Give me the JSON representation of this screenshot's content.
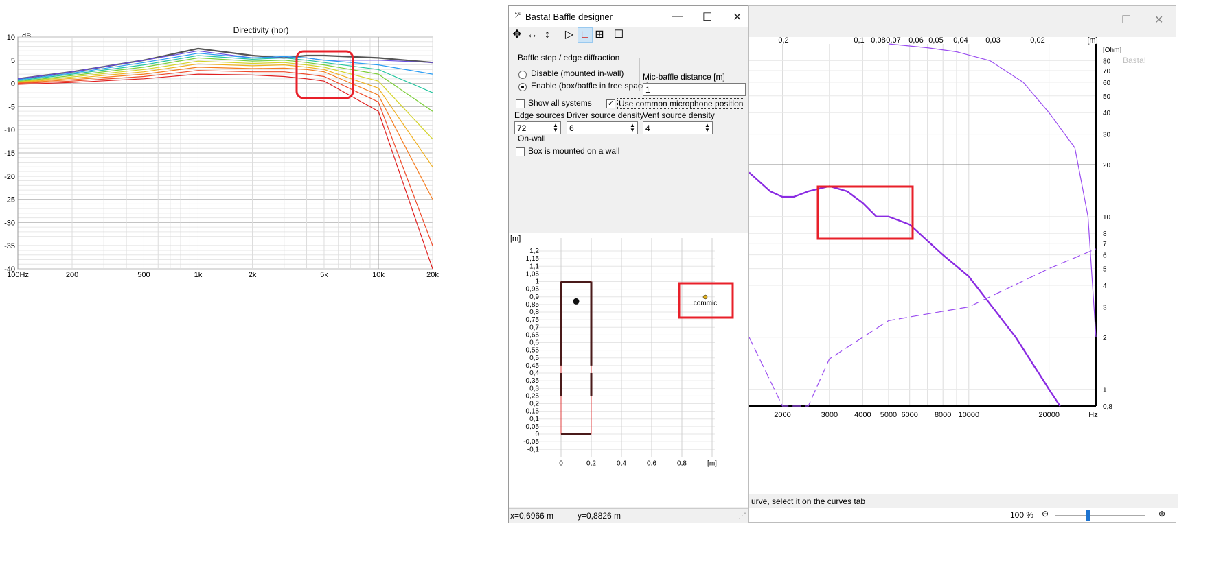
{
  "directivity": {
    "title": "Directivity (hor)",
    "y_unit": "dB",
    "y_ticks": [
      "10",
      "5",
      "0",
      "-5",
      "-10",
      "-15",
      "-20",
      "-25",
      "-30",
      "-35",
      "-40"
    ],
    "x_ticks": [
      "100Hz",
      "200",
      "500",
      "1k",
      "2k",
      "5k",
      "10k",
      "20k"
    ]
  },
  "chart_data": [
    {
      "type": "line",
      "title": "Directivity (hor)",
      "ylabel": "dB",
      "xlabel": "",
      "x_scale": "log",
      "xlim": [
        100,
        20000
      ],
      "ylim": [
        -40,
        10
      ],
      "grid": true,
      "series": [
        {
          "color": "#555555",
          "x": [
            100,
            200,
            500,
            1000,
            2000,
            3000,
            4000,
            5000,
            10000,
            20000
          ],
          "values": [
            1,
            2.5,
            5,
            7.5,
            6,
            5.5,
            6,
            6,
            5.5,
            4.5
          ]
        },
        {
          "color": "#6a4fe0",
          "x": [
            100,
            200,
            500,
            1000,
            2000,
            3000,
            4000,
            5000,
            10000,
            20000
          ],
          "values": [
            1,
            2.5,
            5,
            7,
            5.5,
            5.5,
            5.5,
            5,
            5,
            4.5
          ]
        },
        {
          "color": "#2a9df4",
          "x": [
            100,
            200,
            500,
            1000,
            2000,
            3000,
            4000,
            5000,
            10000,
            20000
          ],
          "values": [
            0.8,
            2.2,
            4.5,
            6.5,
            5.5,
            5.8,
            5.5,
            5,
            4,
            2
          ]
        },
        {
          "color": "#26c6a0",
          "x": [
            100,
            200,
            500,
            1000,
            2000,
            3000,
            4000,
            5000,
            10000,
            20000
          ],
          "values": [
            0.6,
            2,
            4,
            6,
            5.2,
            5.5,
            5,
            4.5,
            3,
            -2
          ]
        },
        {
          "color": "#7ccf3a",
          "x": [
            100,
            200,
            500,
            1000,
            2000,
            3000,
            4000,
            5000,
            10000,
            20000
          ],
          "values": [
            0.4,
            1.7,
            3.5,
            5.5,
            4.8,
            5,
            4.5,
            4,
            2,
            -6
          ]
        },
        {
          "color": "#d4d42a",
          "x": [
            100,
            200,
            500,
            1000,
            2000,
            3000,
            4000,
            5000,
            10000,
            20000
          ],
          "values": [
            0.3,
            1.4,
            3,
            4.8,
            4.3,
            4.5,
            4,
            3.5,
            0.5,
            -12
          ]
        },
        {
          "color": "#f0b020",
          "x": [
            100,
            200,
            500,
            1000,
            2000,
            3000,
            4000,
            5000,
            10000,
            20000
          ],
          "values": [
            0.2,
            1.1,
            2.5,
            4.2,
            3.8,
            4,
            3.5,
            3,
            -1,
            -18
          ]
        },
        {
          "color": "#f57c1f",
          "x": [
            100,
            200,
            500,
            1000,
            2000,
            3000,
            4000,
            5000,
            10000,
            20000
          ],
          "values": [
            0.1,
            0.8,
            2,
            3.5,
            3.2,
            3.3,
            3,
            2.5,
            -2.5,
            -25
          ]
        },
        {
          "color": "#ef4a2a",
          "x": [
            100,
            200,
            500,
            1000,
            2000,
            3000,
            4000,
            5000,
            10000,
            20000
          ],
          "values": [
            0,
            0.5,
            1.5,
            2.8,
            2.5,
            2.5,
            2,
            1.5,
            -4,
            -35
          ]
        },
        {
          "color": "#e02020",
          "x": [
            100,
            200,
            500,
            1000,
            2000,
            3000,
            4000,
            5000,
            10000,
            20000
          ],
          "values": [
            -0.2,
            0.2,
            1,
            2,
            1.8,
            1.5,
            1,
            0.5,
            -6,
            -40
          ]
        }
      ]
    },
    {
      "type": "line",
      "title": "",
      "x_scale": "log",
      "xlim": [
        1500,
        30000
      ],
      "ylim": [
        0.8,
        100
      ],
      "y_right_unit": "[Ohm]",
      "top_unit": "[m]",
      "grid": true,
      "series": [
        {
          "color": "#8a2be2",
          "style": "solid",
          "x": [
            1500,
            1800,
            2000,
            2200,
            2500,
            3000,
            3500,
            4000,
            4500,
            5000,
            6000,
            8000,
            10000,
            15000,
            20000,
            22000
          ],
          "values": [
            18,
            14,
            13,
            13,
            14,
            15,
            14,
            12,
            10,
            10,
            9,
            6,
            4.5,
            2,
            1,
            0.8
          ]
        },
        {
          "color": "#9a4df0",
          "style": "dashed",
          "x": [
            1500,
            2000,
            2500,
            3000,
            5000,
            10000,
            20000,
            30000
          ],
          "values": [
            2,
            0.8,
            0.8,
            1.5,
            2.5,
            3,
            5,
            6.5
          ]
        },
        {
          "color": "#9a4df0",
          "style": "solid-thin",
          "x": [
            5000,
            7000,
            9000,
            12000,
            16000,
            20000,
            25000,
            28000,
            30000
          ],
          "values": [
            100,
            95,
            90,
            80,
            60,
            40,
            25,
            10,
            2
          ]
        }
      ],
      "highlight": "red rectangle around the 2.5k–4.5k hump"
    }
  ],
  "resp": {
    "top_ticks": [
      "0,2",
      "0,1",
      "0,08",
      "0,07",
      "0,06",
      "0,05",
      "0,04",
      "0,03",
      "0,02",
      "[m]"
    ],
    "right_ticks": [
      "[Ohm]",
      "80",
      "70",
      "60",
      "50",
      "40",
      "30",
      "20",
      "10",
      "8",
      "7",
      "6",
      "5",
      "4",
      "3",
      "2",
      "1",
      "0,8"
    ],
    "x_ticks": [
      "2000",
      "3000",
      "4000",
      "5000",
      "6000",
      "8000",
      "10000",
      "20000",
      "Hz"
    ],
    "watermark": "Basta!",
    "status_text": "urve, select it on the curves tab",
    "zoom_label": "100 %"
  },
  "baffle": {
    "title": "Basta!   Baffle designer",
    "group_title": "Baffle step / edge diffraction",
    "radio_disable": "Disable (mounted in-wall)",
    "radio_enable": "Enable (box/baffle in free space)",
    "mic_label": "Mic-baffle distance [m]",
    "mic_value": "1",
    "show_all": "Show all systems",
    "common_mic": "Use common microphone position",
    "edge_label": "Edge sources",
    "edge_value": "72",
    "driver_label": "Driver source density",
    "driver_value": "6",
    "vent_label": "Vent source density",
    "vent_value": "4",
    "onwall_title": "On-wall",
    "onwall_check": "Box is mounted on a wall",
    "canvas_unit": "[m]",
    "y_ticks": [
      "1,2",
      "1,15",
      "1,1",
      "1,05",
      "1",
      "0,95",
      "0,9",
      "0,85",
      "0,8",
      "0,75",
      "0,7",
      "0,65",
      "0,6",
      "0,55",
      "0,5",
      "0,45",
      "0,4",
      "0,35",
      "0,3",
      "0,25",
      "0,2",
      "0,15",
      "0,1",
      "0,05",
      "0",
      "-0,05",
      "-0,1"
    ],
    "x_ticks": [
      "0",
      "0,2",
      "0,4",
      "0,6",
      "0,8",
      "[m]"
    ],
    "mic_marker_label": "commic",
    "status_x": "x=0,6966 m",
    "status_y": "y=0,8826 m"
  }
}
